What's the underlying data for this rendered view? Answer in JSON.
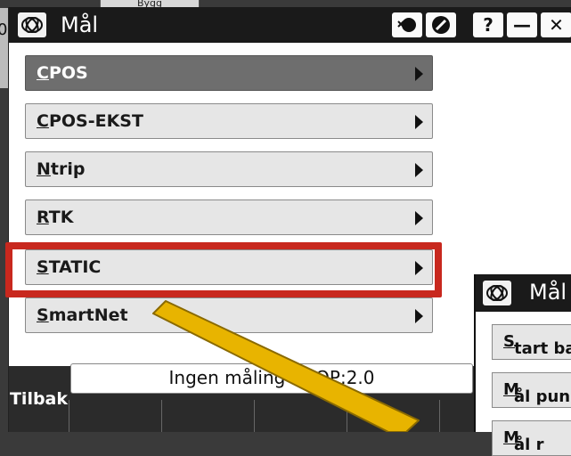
{
  "background": {
    "top_tab_label": "Bygg",
    "left_edge_char": "0"
  },
  "window": {
    "title": "Mål",
    "logo_icon": "trimble-globe-icon",
    "title_buttons": [
      {
        "name": "satellite-icon"
      },
      {
        "name": "no-entry-icon"
      },
      {
        "name": "help-icon",
        "glyph": "?"
      },
      {
        "name": "minimize-icon",
        "glyph": "—"
      },
      {
        "name": "close-icon",
        "glyph": "✕"
      }
    ]
  },
  "menu": {
    "items": [
      {
        "label_first": "C",
        "label_rest": "POS"
      },
      {
        "label_first": "C",
        "label_rest": "POS-EKST"
      },
      {
        "label_first": "N",
        "label_rest": "trip"
      },
      {
        "label_first": "R",
        "label_rest": "TK"
      },
      {
        "label_first": "S",
        "label_rest": "TATIC"
      },
      {
        "label_first": "S",
        "label_rest": "martNet"
      }
    ]
  },
  "status": {
    "text": "Ingen måling PDOP:2.0"
  },
  "footer": {
    "back_label": "Tilbak"
  },
  "window2": {
    "title": "Mål",
    "buttons": [
      {
        "label_first": "S",
        "label_rest": "tart ba"
      },
      {
        "label_first": "M",
        "label_rest": "ål pun"
      },
      {
        "label_first": "M",
        "label_rest": "ål r"
      }
    ]
  },
  "colors": {
    "highlight": "#c8281e",
    "pointer_fill": "#e8b400",
    "titlebar": "#1a1a1a",
    "active_item": "#6e6e6e"
  }
}
